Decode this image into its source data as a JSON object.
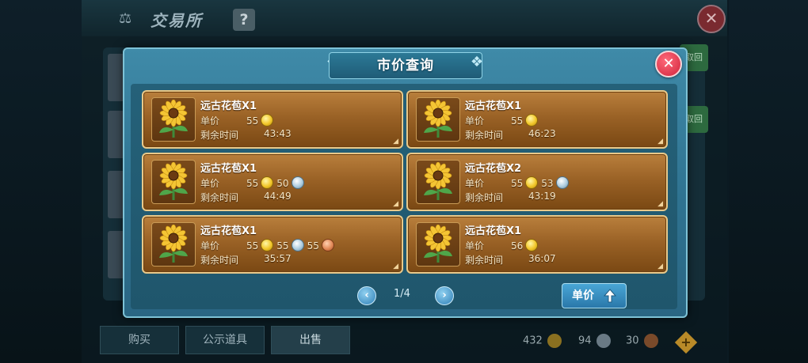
{
  "background": {
    "title": "交易所",
    "help_label": "?",
    "close_label": "✕",
    "side_button_label": "取回",
    "tabs": [
      "购买",
      "公示道具",
      "出售"
    ],
    "currency": {
      "gold": "432",
      "silver": "94",
      "bronze": "30"
    }
  },
  "modal": {
    "title": "市价查询",
    "close_label": "✕",
    "listings": [
      {
        "name": "远古花苞X1",
        "price_label": "单价",
        "time_label": "剩余时间",
        "gold": "55",
        "time": "43:43"
      },
      {
        "name": "远古花苞X1",
        "price_label": "单价",
        "time_label": "剩余时间",
        "gold": "55",
        "time": "46:23"
      },
      {
        "name": "远古花苞X1",
        "price_label": "单价",
        "time_label": "剩余时间",
        "gold": "55",
        "silver": "50",
        "time": "44:49"
      },
      {
        "name": "远古花苞X2",
        "price_label": "单价",
        "time_label": "剩余时间",
        "gold": "55",
        "silver": "53",
        "time": "43:19"
      },
      {
        "name": "远古花苞X1",
        "price_label": "单价",
        "time_label": "剩余时间",
        "gold": "55",
        "silver": "55",
        "bronze": "55",
        "time": "35:57"
      },
      {
        "name": "远古花苞X1",
        "price_label": "单价",
        "time_label": "剩余时间",
        "gold": "56",
        "time": "36:07"
      }
    ],
    "pager": {
      "prev": "‹",
      "next": "›",
      "text": "1/4"
    },
    "sort_label": "单价"
  },
  "colors": {
    "gold": "#f2c72a",
    "silver": "#aecde0",
    "bronze": "#e38a58",
    "card": "#9a6226",
    "panel": "#2f7391"
  }
}
